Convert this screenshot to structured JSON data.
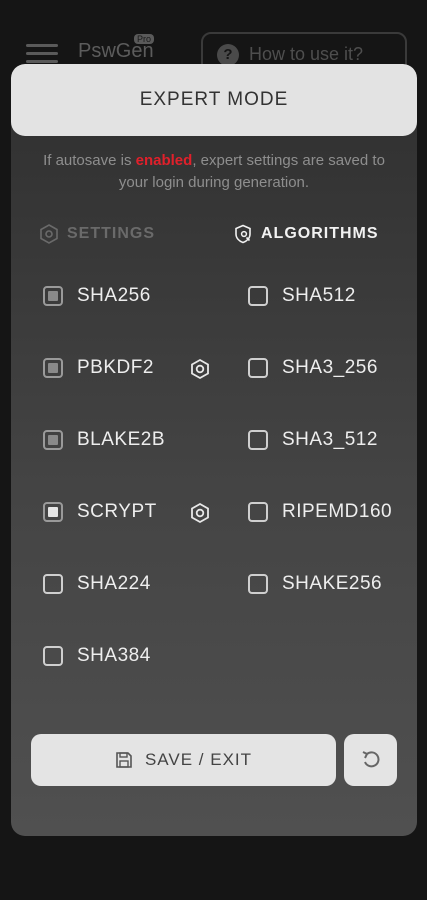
{
  "appbar": {
    "brand": "PswGen",
    "badge": "Pro",
    "howto_label": "How to use it?",
    "howto_icon": "?"
  },
  "modal": {
    "title": "EXPERT MODE",
    "info_prefix": "If autosave is ",
    "info_highlight": "enabled",
    "info_suffix": ", expert settings are saved to your login during generation.",
    "tabs": {
      "settings": "SETTINGS",
      "algorithms": "ALGORITHMS"
    },
    "algorithms": [
      {
        "label": "SHA256",
        "checked": true,
        "has_settings": false
      },
      {
        "label": "SHA512",
        "checked": false,
        "has_settings": false
      },
      {
        "label": "PBKDF2",
        "checked": true,
        "has_settings": true
      },
      {
        "label": "SHA3_256",
        "checked": false,
        "has_settings": false
      },
      {
        "label": "BLAKE2B",
        "checked": true,
        "has_settings": false
      },
      {
        "label": "SHA3_512",
        "checked": false,
        "has_settings": false
      },
      {
        "label": "SCRYPT",
        "checked": true,
        "has_settings": true
      },
      {
        "label": "RIPEMD160",
        "checked": false,
        "has_settings": false
      },
      {
        "label": "SHA224",
        "checked": false,
        "has_settings": false
      },
      {
        "label": "SHAKE256",
        "checked": false,
        "has_settings": false
      },
      {
        "label": "SHA384",
        "checked": false,
        "has_settings": false
      }
    ],
    "save_label": "SAVE / EXIT"
  },
  "colors": {
    "accent_enabled": "#e0202b",
    "header_bg": "#e3e3e3",
    "page_bg": "#151515"
  }
}
